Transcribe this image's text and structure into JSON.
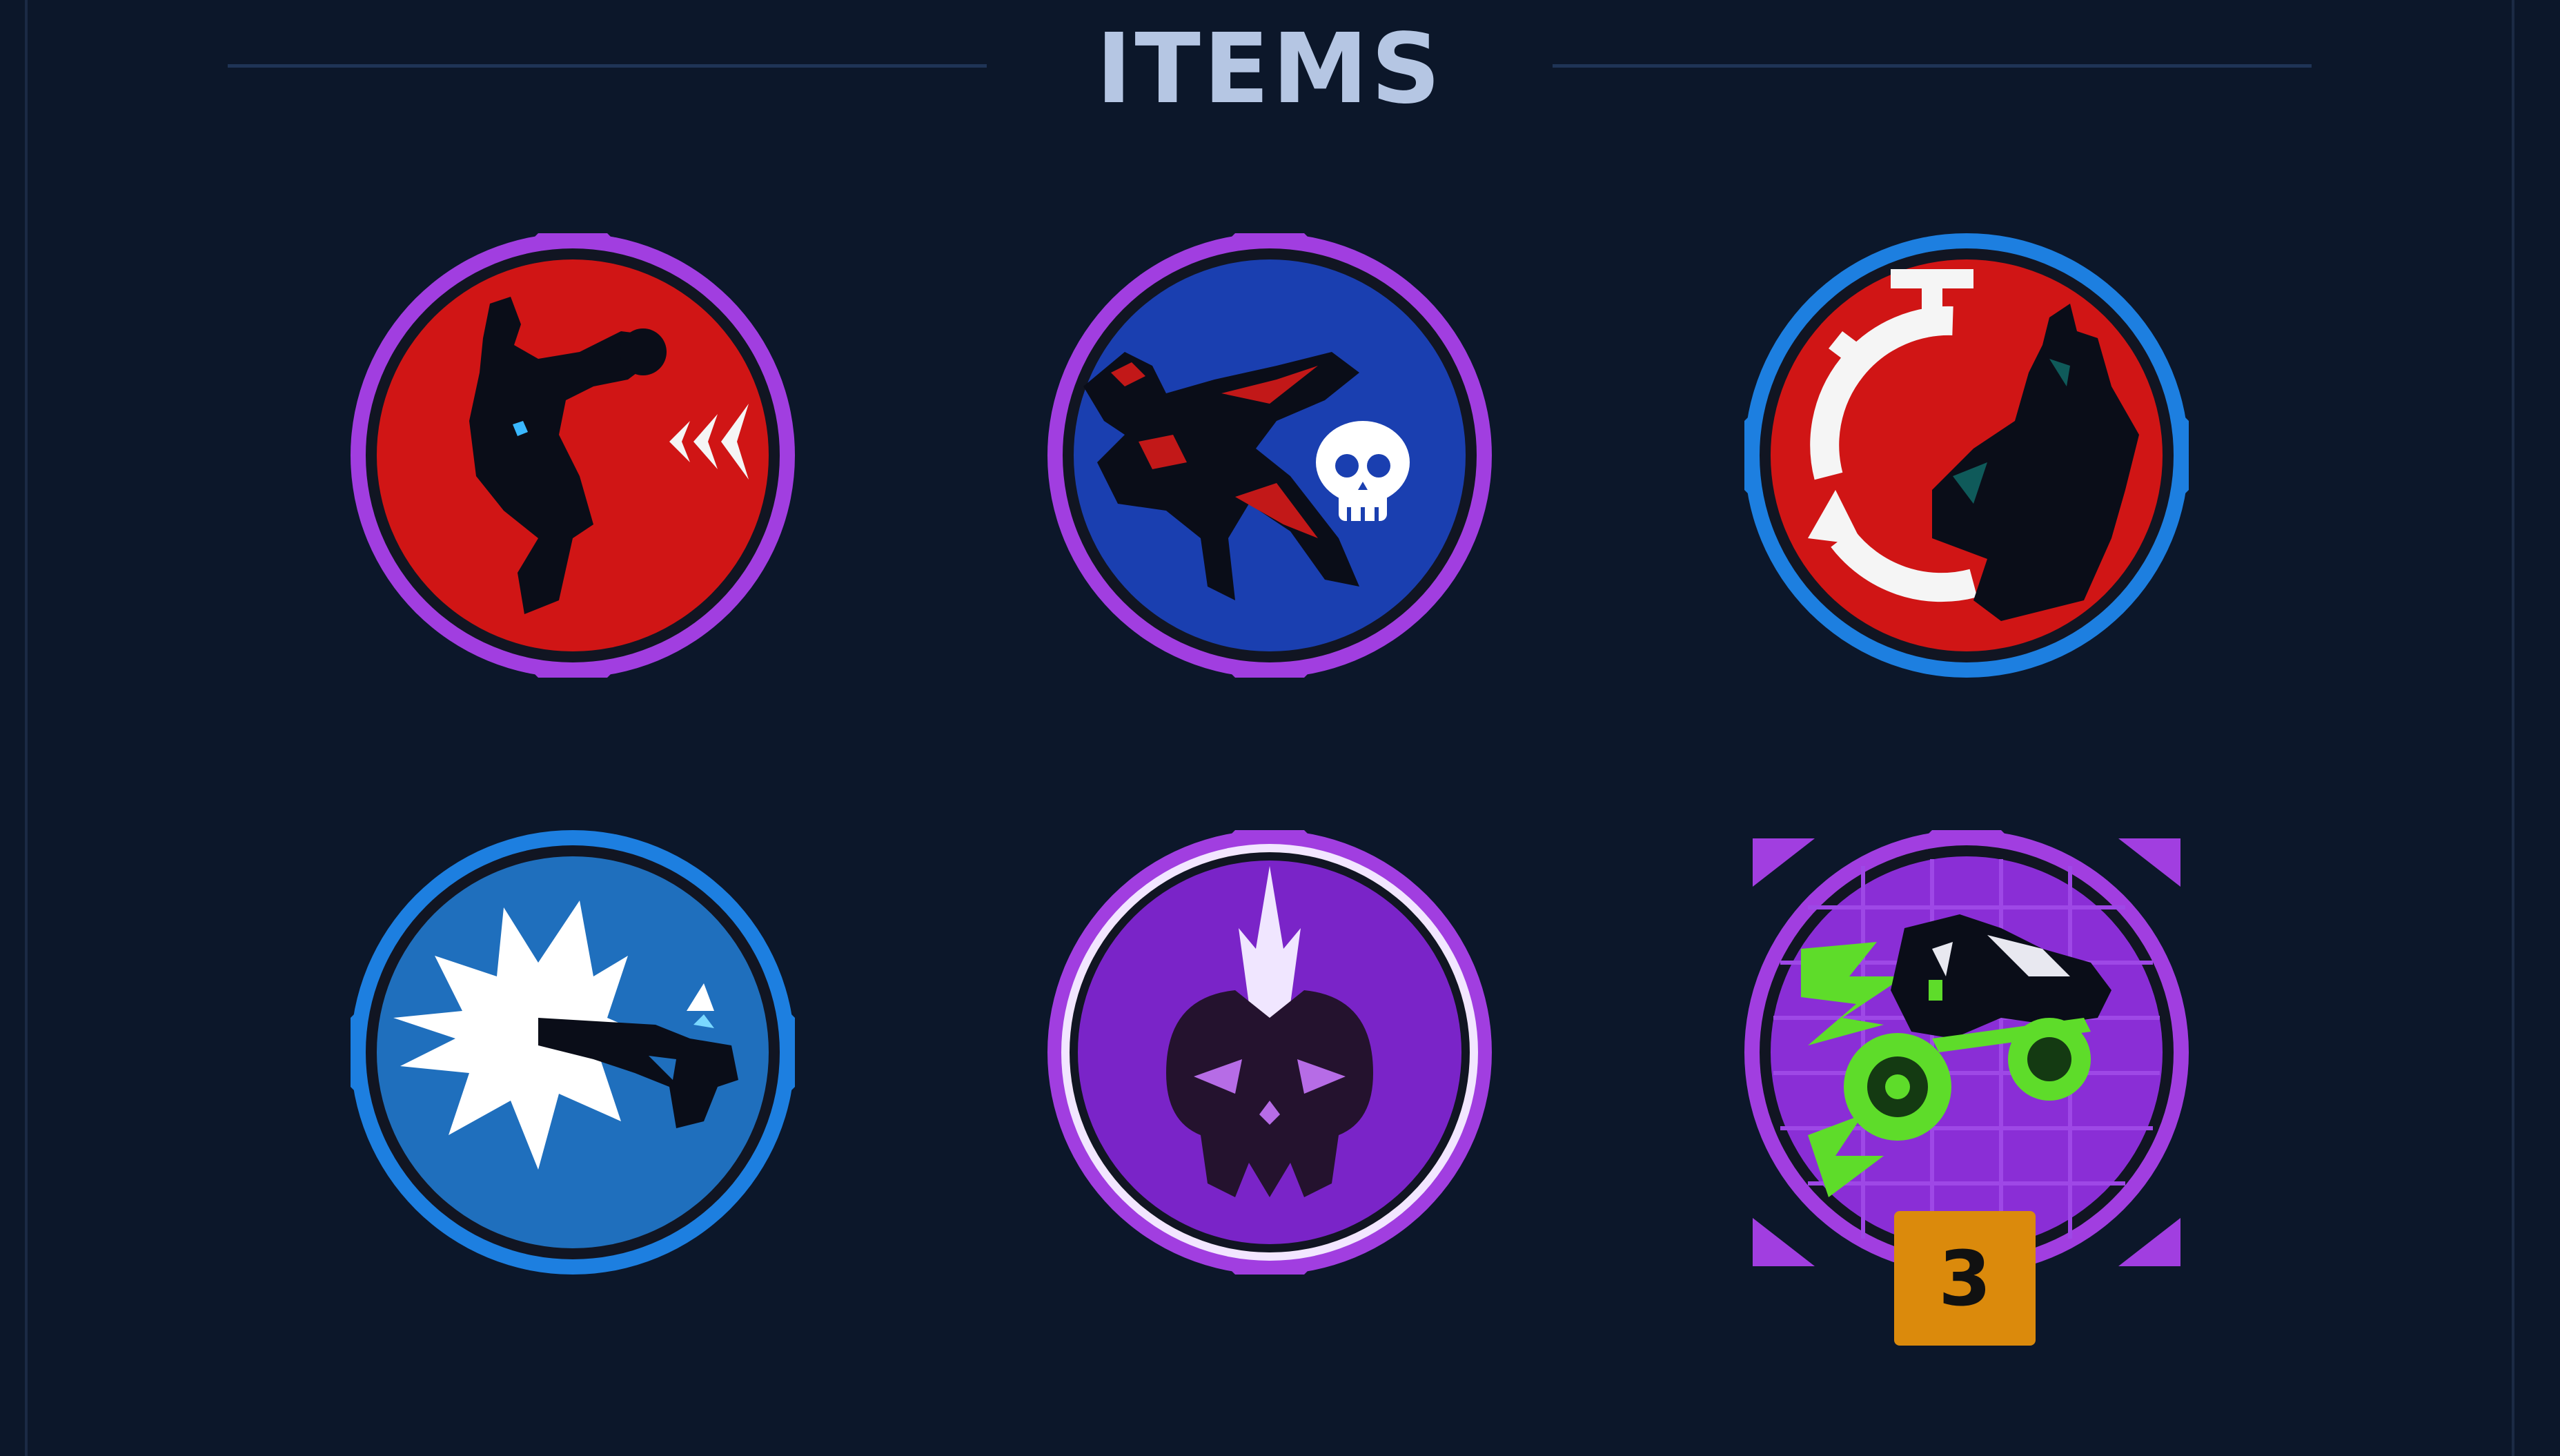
{
  "header": {
    "title": "ITEMS"
  },
  "items": [
    {
      "icon": "rocket-gunner-dash-icon",
      "frame_color": "#a13ee0",
      "bg_color": "#d01515"
    },
    {
      "icon": "leaping-skull-icon",
      "frame_color": "#a13ee0",
      "bg_color": "#1a3fb0"
    },
    {
      "icon": "stopwatch-cooldown-icon",
      "frame_color": "#1d7fe0",
      "bg_color": "#d01515"
    },
    {
      "icon": "pistol-burst-icon",
      "frame_color": "#1d7fe0",
      "bg_color": "#1f6fbd"
    },
    {
      "icon": "mohawk-skull-icon",
      "frame_color": "#a13ee0",
      "bg_color": "#7a24c8"
    },
    {
      "icon": "rocket-skates-icon",
      "frame_color": "#a13ee0",
      "bg_color": "#8a2ed6",
      "stack_count": "3"
    }
  ],
  "colors": {
    "background": "#0c172a",
    "title": "#b5c6e3",
    "badge": "#db8a0c"
  }
}
